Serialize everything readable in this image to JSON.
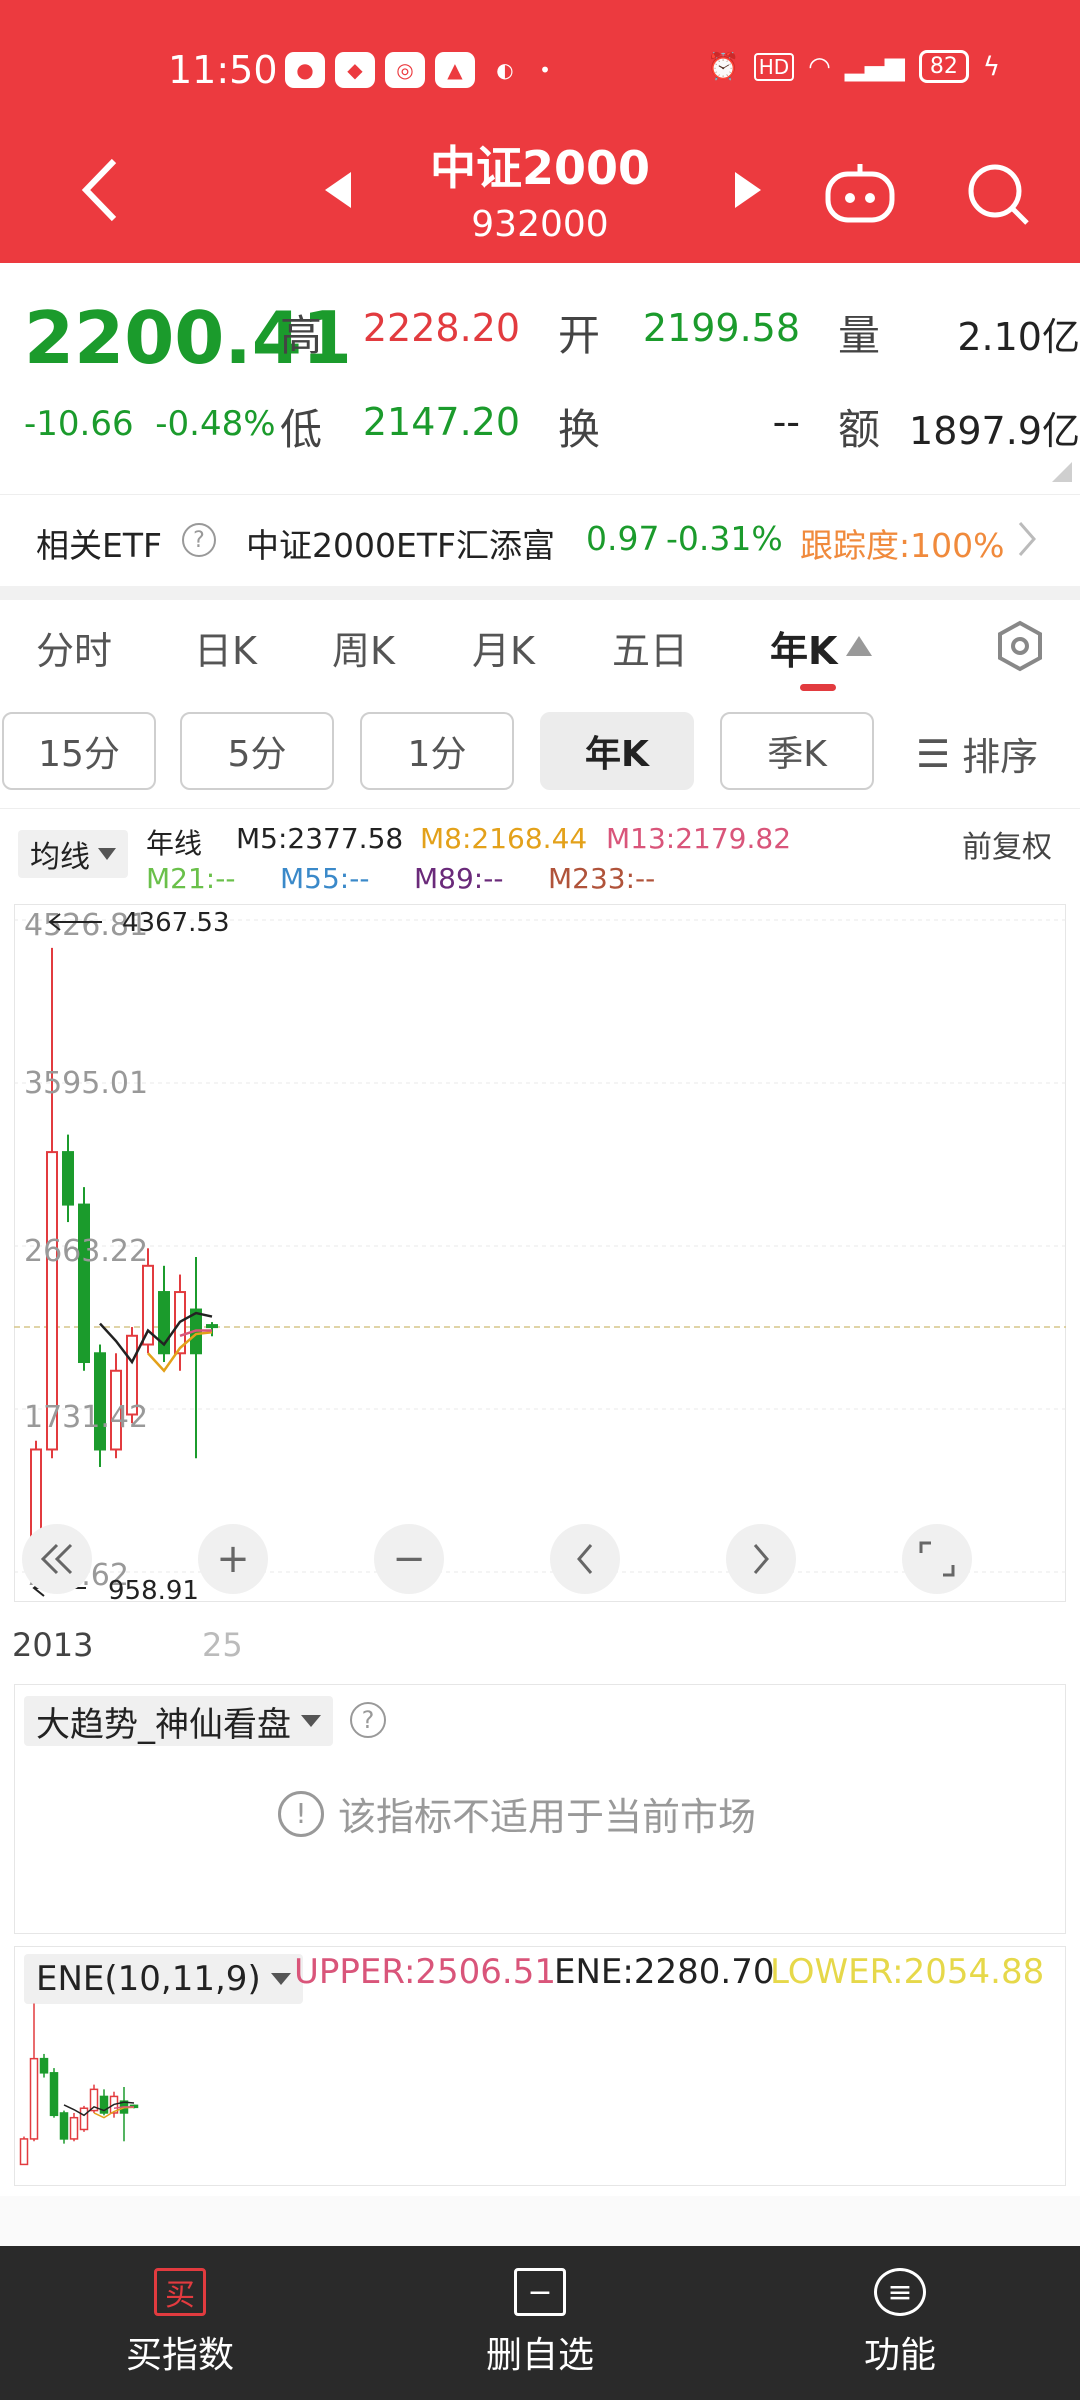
{
  "status_bar": {
    "time": "11:50",
    "battery": "82"
  },
  "nav": {
    "title": "中证2000",
    "code": "932000"
  },
  "quote": {
    "price": "2200.41",
    "change": "-10.66",
    "change_pct": "-0.48%",
    "labels": {
      "high": "高",
      "open": "开",
      "volume": "量",
      "low": "低",
      "turnover": "换",
      "amount": "额"
    },
    "high": "2228.20",
    "open": "2199.58",
    "volume": "2.10亿",
    "low": "2147.20",
    "turnover_val": "--",
    "amount_val": "1897.9亿"
  },
  "etf": {
    "label": "相关ETF",
    "name": "中证2000ETF汇添富",
    "price": "0.97",
    "change_pct": "-0.31%",
    "tracking": "跟踪度:100%"
  },
  "tabs": [
    "分时",
    "日K",
    "周K",
    "月K",
    "五日",
    "年K"
  ],
  "periods": [
    "15分",
    "5分",
    "1分",
    "年K",
    "季K",
    "排序"
  ],
  "ma": {
    "select": "均线",
    "type": "年线",
    "fq": "前复权",
    "m5": "M5:2377.58",
    "m8": "M8:2168.44",
    "m13": "M13:2179.82",
    "m21": "M21:--",
    "m55": "M55:--",
    "m89": "M89:--",
    "m233": "M233:--"
  },
  "colors": {
    "header": "#ec3a3f",
    "up": "#e23b3f",
    "down": "#1b9b2c",
    "m5": "#222222",
    "m8": "#e3a11a",
    "m13": "#d9557a"
  },
  "chart_data": {
    "type": "candlestick",
    "y_ticks": [
      "4526.81",
      "3595.01",
      "2663.22",
      "1731.42",
      "799.62"
    ],
    "max_label": "4367.53",
    "min_label": "958.91",
    "x_labels": [
      "2013",
      "25"
    ],
    "ylim": [
      799.62,
      4526.81
    ],
    "candles": [
      {
        "o": 960,
        "c": 1500,
        "h": 1550,
        "l": 958.91,
        "up": true
      },
      {
        "o": 1500,
        "c": 3200,
        "h": 4367.53,
        "l": 1450,
        "up": true
      },
      {
        "o": 3200,
        "c": 2900,
        "h": 3300,
        "l": 2800,
        "up": false
      },
      {
        "o": 2900,
        "c": 2000,
        "h": 3000,
        "l": 1950,
        "up": false
      },
      {
        "o": 2050,
        "c": 1500,
        "h": 2100,
        "l": 1400,
        "up": false
      },
      {
        "o": 1500,
        "c": 1950,
        "h": 2050,
        "l": 1450,
        "up": true
      },
      {
        "o": 1700,
        "c": 2150,
        "h": 2200,
        "l": 1650,
        "up": true
      },
      {
        "o": 2100,
        "c": 2550,
        "h": 2650,
        "l": 2050,
        "up": true
      },
      {
        "o": 2400,
        "c": 2050,
        "h": 2550,
        "l": 2000,
        "up": false
      },
      {
        "o": 2050,
        "c": 2400,
        "h": 2500,
        "l": 1950,
        "up": true
      },
      {
        "o": 2300,
        "c": 2050,
        "h": 2600,
        "l": 1450,
        "up": false
      },
      {
        "o": 2211.07,
        "c": 2200.41,
        "h": 2228.2,
        "l": 2147.2,
        "up": false
      }
    ],
    "ma5": [
      null,
      null,
      null,
      null,
      2220,
      2120,
      2000,
      2180,
      2100,
      2230,
      2280,
      2260
    ],
    "ma8": [
      null,
      null,
      null,
      null,
      null,
      null,
      null,
      2050,
      1950,
      2080,
      2160,
      2170
    ],
    "ma13": [
      null,
      null,
      null,
      null,
      null,
      null,
      null,
      null,
      null,
      2150,
      2180,
      2180
    ]
  },
  "indicator1": {
    "select": "大趋势_神仙看盘",
    "message": "该指标不适用于当前市场"
  },
  "indicator2": {
    "select": "ENE(10,11,9)",
    "upper": "UPPER:2506.51",
    "ene": "ENE:2280.70",
    "lower": "LOWER:2054.88"
  },
  "bottom": {
    "buy": "买指数",
    "buy_icon": "买",
    "delete": "删自选",
    "func": "功能"
  }
}
